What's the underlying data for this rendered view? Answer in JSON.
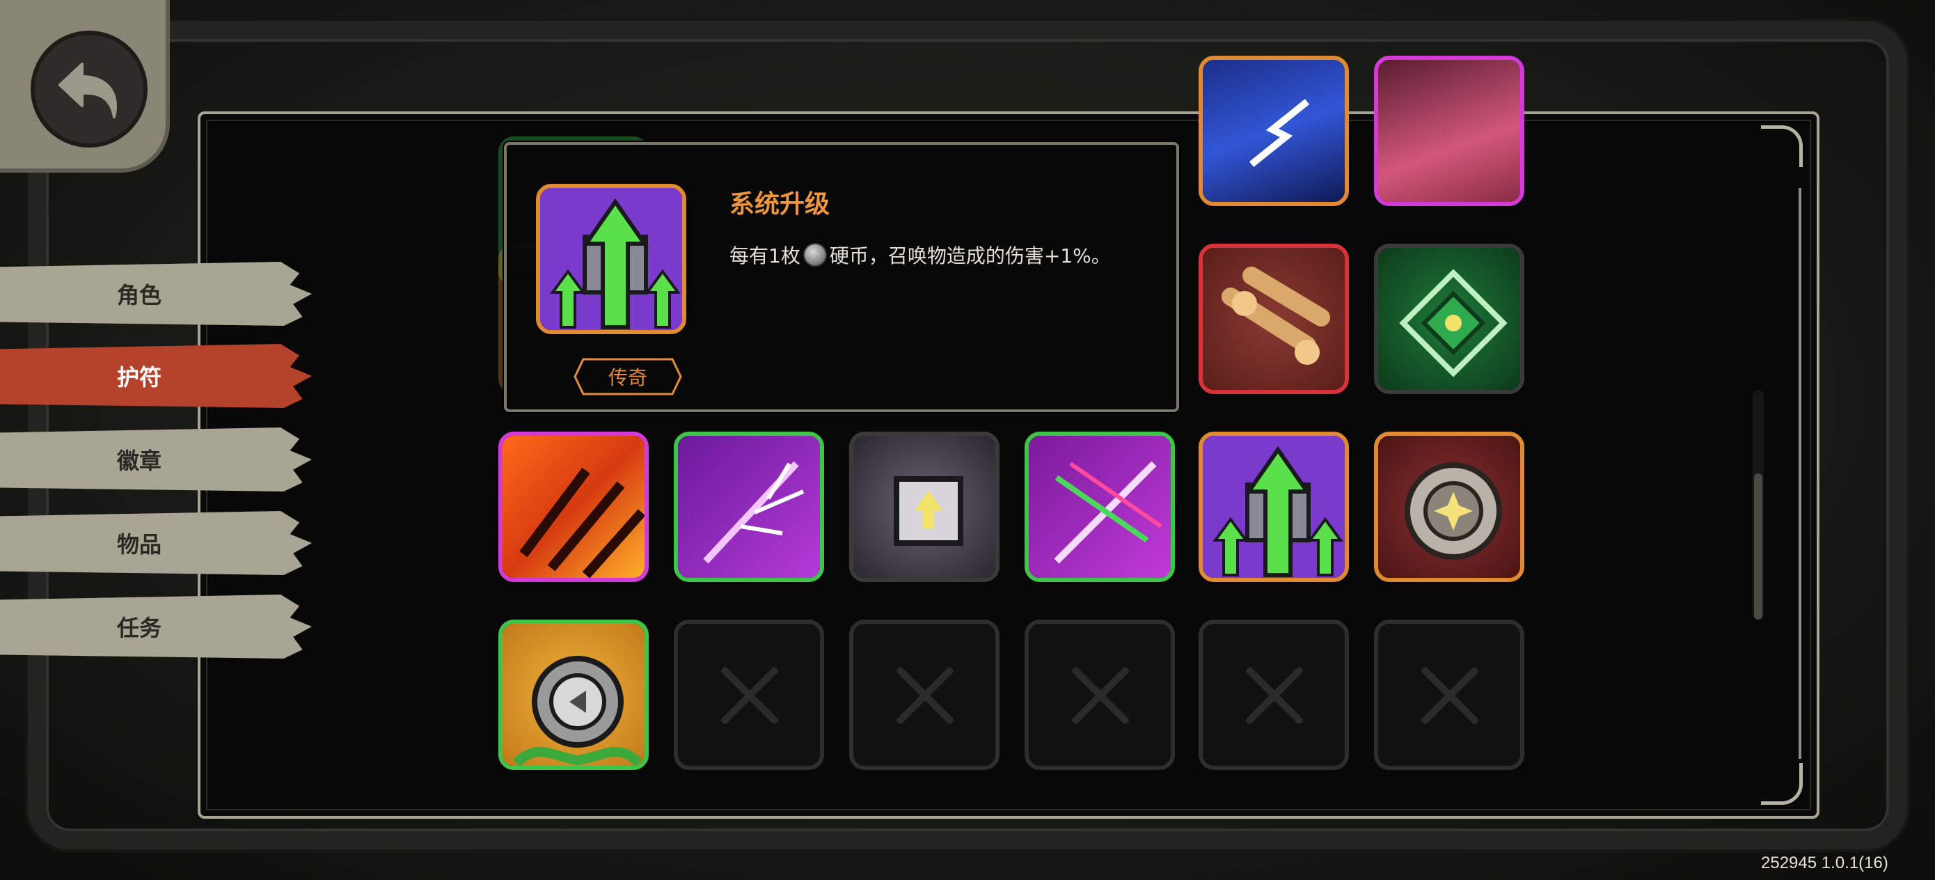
{
  "menu": {
    "tabs": [
      {
        "label": "角色",
        "active": false
      },
      {
        "label": "护符",
        "active": true
      },
      {
        "label": "徽章",
        "active": false
      },
      {
        "label": "物品",
        "active": false
      },
      {
        "label": "任务",
        "active": false
      }
    ]
  },
  "tooltip": {
    "title": "系统升级",
    "desc_before_coin": "每有1枚",
    "desc_after_coin": "硬币，召唤物造成的伤害+1%。",
    "rarity": "传奇",
    "icon": "system-upgrade-icon"
  },
  "version_text": "252945 1.0.1(16)",
  "colors": {
    "legendary_orange": "#e08a32",
    "epic_purple": "#d43ad8",
    "uncommon_green": "#3ec64a",
    "rare_red": "#d8323a",
    "common_gray": "#3a3a3a",
    "active_tab": "#b5422b",
    "inactive_tab": "#a8a594"
  },
  "slots": {
    "row_top_partial": [
      "claw-lightning-blue-icon",
      "pink-beast-icon"
    ],
    "row_two": [
      "double-fist-icon",
      "green-rune-diamond-icon"
    ],
    "row_three": [
      "fire-claw-icon",
      "purple-branch-icon",
      "tech-portal-icon",
      "crossed-blades-icon",
      "system-upgrade-icon",
      "silver-medallion-icon"
    ],
    "row_four": [
      "silver-coin-icon",
      "empty",
      "empty",
      "empty",
      "empty",
      "empty"
    ]
  }
}
